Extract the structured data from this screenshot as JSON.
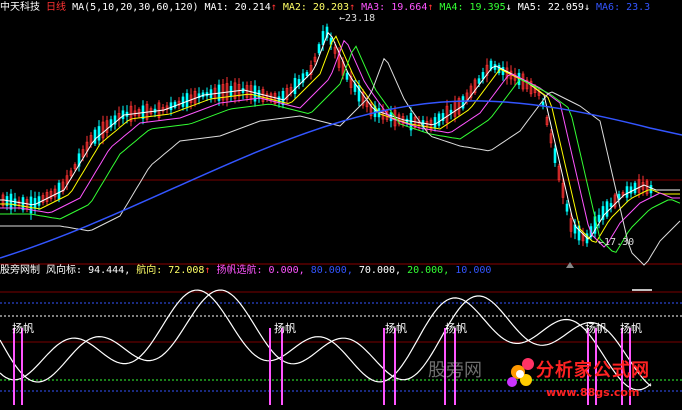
{
  "top_bar": {
    "stock_name": "中天科技",
    "period": "日线",
    "ma_params": "MA(5,10,20,30,60,120)",
    "ma1": "MA1: 20.214",
    "ma1_arrow": "↑",
    "ma2": "MA2: 20.203",
    "ma2_arrow": "↑",
    "ma3": "MA3: 19.664",
    "ma3_arrow": "↑",
    "ma4": "MA4: 19.395",
    "ma4_arrow": "↓",
    "ma5": "MA5: 22.059",
    "ma5_arrow": "↓",
    "ma6": "MA6: 23.3"
  },
  "price_labels": {
    "high": "23.18",
    "low": "17.30"
  },
  "indicator_bar": {
    "name": "股旁网制",
    "wind_label": "风向标: 94.444,",
    "heading_label": "航向: 72.008",
    "heading_arrow": "↑",
    "sail_label": "扬帆选航:",
    "v1": "0.000,",
    "v2": "80.000,",
    "v3": "70.000,",
    "v4": "20.000,",
    "v5": "10.000"
  },
  "signals": [
    "扬帆",
    "扬帆",
    "扬帆",
    "扬帆",
    "扬帆",
    "扬帆"
  ],
  "watermark": {
    "text": "股旁网",
    "brand": "分析家公式网",
    "url": "www.88gs.com"
  },
  "colors": {
    "up": "#ff3333",
    "down": "#00ffff",
    "ma1": "#ffffff",
    "ma2": "#ffff00",
    "ma3": "#ff55ff",
    "ma4": "#33ff33",
    "ma5": "#dddddd",
    "ma6": "#3355ff"
  }
}
